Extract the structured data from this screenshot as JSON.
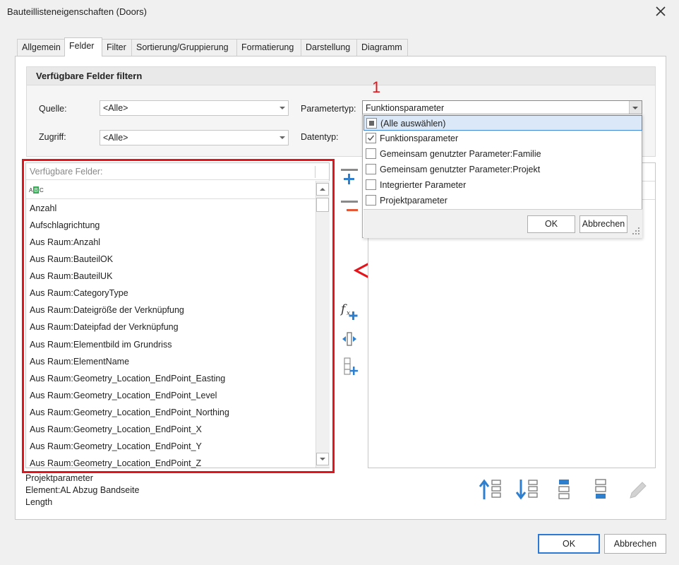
{
  "window": {
    "title": "Bauteillisteneigenschaften (Doors)"
  },
  "tabs": [
    "Allgemein",
    "Felder",
    "Filter",
    "Sortierung/Gruppierung",
    "Formatierung",
    "Darstellung",
    "Diagramm"
  ],
  "filter_group": {
    "title": "Verfügbare Felder filtern",
    "quelle_label": "Quelle:",
    "quelle_value": "<Alle>",
    "zugriff_label": "Zugriff:",
    "zugriff_value": "<Alle>",
    "parametertyp_label": "Parametertyp:",
    "parametertyp_value": "Funktionsparameter",
    "datentyp_label": "Datentyp:"
  },
  "annotation_number": "1",
  "dropdown": {
    "options": [
      {
        "label": "(Alle auswählen)",
        "state": "partial"
      },
      {
        "label": "Funktionsparameter",
        "state": "checked"
      },
      {
        "label": "Gemeinsam genutzter Parameter:Familie",
        "state": "unchecked"
      },
      {
        "label": "Gemeinsam genutzter Parameter:Projekt",
        "state": "unchecked"
      },
      {
        "label": "Integrierter Parameter",
        "state": "unchecked"
      },
      {
        "label": "Projektparameter",
        "state": "unchecked"
      }
    ],
    "ok_label": "OK",
    "cancel_label": "Abbrechen"
  },
  "available_fields": {
    "header": "Verfügbare Felder:",
    "items": [
      "Anzahl",
      "Aufschlagrichtung",
      "Aus Raum:Anzahl",
      "Aus Raum:BauteilOK",
      "Aus Raum:BauteilUK",
      "Aus Raum:CategoryType",
      "Aus Raum:Dateigröße der Verknüpfung",
      "Aus Raum:Dateipfad der Verknüpfung",
      "Aus Raum:Elementbild im Grundriss",
      "Aus Raum:ElementName",
      "Aus Raum:Geometry_Location_EndPoint_Easting",
      "Aus Raum:Geometry_Location_EndPoint_Level",
      "Aus Raum:Geometry_Location_EndPoint_Northing",
      "Aus Raum:Geometry_Location_EndPoint_X",
      "Aus Raum:Geometry_Location_EndPoint_Y",
      "Aus Raum:Geometry_Location_EndPoint_Z"
    ]
  },
  "field_info": {
    "line1": "Projektparameter",
    "line2": "Element:AL Abzug Bandseite",
    "line3": "Length"
  },
  "footer": {
    "ok_label": "OK",
    "cancel_label": "Abbrechen"
  },
  "colors": {
    "accent": "#2c7ad6",
    "highlight_red": "#e3141b",
    "icon_blue": "#2f7fcf",
    "icon_red": "#e05a3a"
  }
}
